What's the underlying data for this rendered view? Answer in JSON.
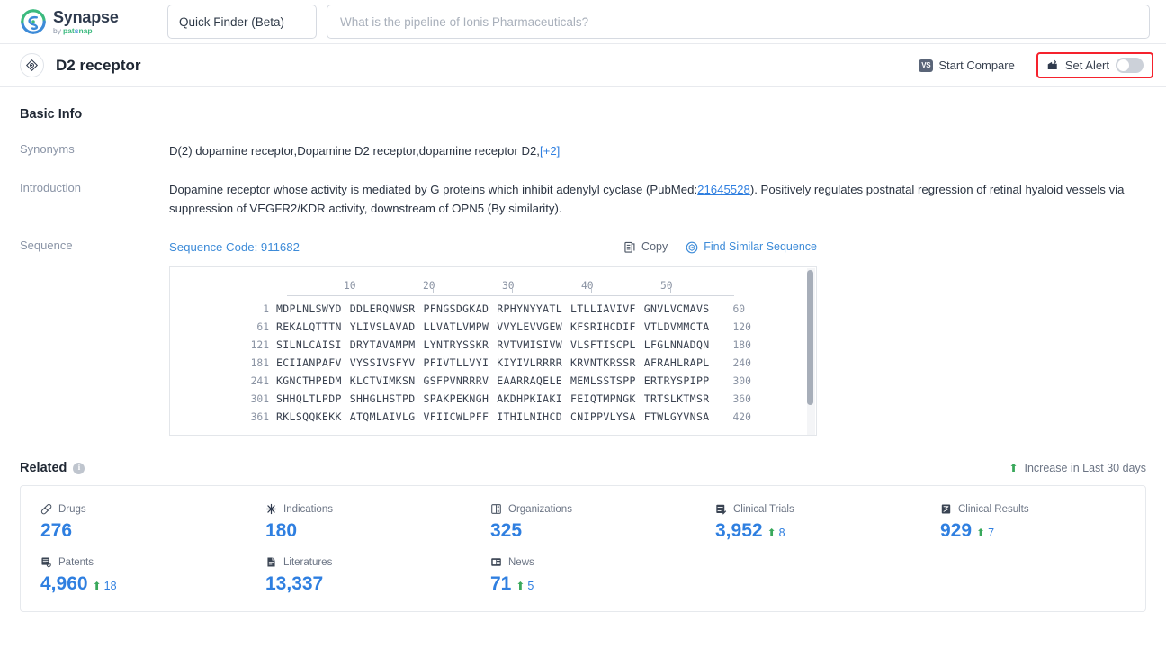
{
  "header": {
    "logo_name": "Synapse",
    "logo_sub_prefix": "by",
    "logo_sub_brand": "patsnap",
    "finder_label": "Quick Finder (Beta)",
    "search_placeholder": "What is the pipeline of Ionis Pharmaceuticals?",
    "caret_icon": "chevron-down-icon"
  },
  "titlebar": {
    "entity_icon": "target-diamond-icon",
    "title": "D2 receptor",
    "compare_label": "Start Compare",
    "compare_icon": "vs-icon",
    "vs_text": "VS",
    "alert_label": "Set Alert",
    "alert_icon": "alert-bell-icon",
    "alert_toggle_state": "off",
    "alert_highlight_color": "#f5222d"
  },
  "basic_info": {
    "section_title": "Basic Info",
    "synonyms_label": "Synonyms",
    "synonyms_value": "D(2) dopamine receptor,Dopamine D2 receptor,dopamine receptor D2,",
    "synonyms_more": "[+2]",
    "introduction_label": "Introduction",
    "introduction_part1": "Dopamine receptor whose activity is mediated by G proteins which inhibit adenylyl cyclase (PubMed:",
    "introduction_pubmed": "21645528",
    "introduction_part2": "). Positively regulates postnatal regression of retinal hyaloid vessels via suppression of VEGFR2/KDR activity, downstream of OPN5 (By similarity)."
  },
  "sequence": {
    "label": "Sequence",
    "code_text": "Sequence Code: 911682",
    "copy_label": "Copy",
    "copy_icon": "copy-icon",
    "find_similar_label": "Find Similar Sequence",
    "find_similar_icon": "find-similar-sequence-icon",
    "ruler_ticks": [
      "10",
      "20",
      "30",
      "40",
      "50"
    ],
    "lines": [
      {
        "start": "1",
        "chunks": [
          "MDPLNLSWYD",
          "DDLERQNWSR",
          "PFNGSDGKAD",
          "RPHYNYYATL",
          "LTLLIAVIVF",
          "GNVLVCMAVS"
        ],
        "end": "60"
      },
      {
        "start": "61",
        "chunks": [
          "REKALQTTTN",
          "YLIVSLAVAD",
          "LLVATLVMPW",
          "VVYLEVVGEW",
          "KFSRIHCDIF",
          "VTLDVMMCTA"
        ],
        "end": "120"
      },
      {
        "start": "121",
        "chunks": [
          "SILNLCAISI",
          "DRYTAVAMPM",
          "LYNTRYSSKR",
          "RVTVMISIVW",
          "VLSFTISCPL",
          "LFGLNNADQN"
        ],
        "end": "180"
      },
      {
        "start": "181",
        "chunks": [
          "ECIIANPAFV",
          "VYSSIVSFYV",
          "PFIVTLLVYI",
          "KIYIVLRRRR",
          "KRVNTKRSSR",
          "AFRAHLRAPL"
        ],
        "end": "240"
      },
      {
        "start": "241",
        "chunks": [
          "KGNCTHPEDM",
          "KLCTVIMKSN",
          "GSFPVNRRRV",
          "EAARRAQELE",
          "MEMLSSTSPP",
          "ERTRYSPIPP"
        ],
        "end": "300"
      },
      {
        "start": "301",
        "chunks": [
          "SHHQLTLPDP",
          "SHHGLHSTPD",
          "SPAKPEKNGH",
          "AKDHPKIAKI",
          "FEIQTMPNGK",
          "TRTSLKTMSR"
        ],
        "end": "360"
      },
      {
        "start": "361",
        "chunks": [
          "RKLSQQKEKK",
          "ATQMLAIVLG",
          "VFIICWLPFF",
          "ITHILNIHCD",
          "CNIPPVLYSA",
          "FTWLGYVNSA"
        ],
        "end": "420"
      }
    ]
  },
  "related": {
    "title": "Related",
    "info_icon": "info-icon",
    "info_glyph": "i",
    "increase_note": "Increase in Last 30 days",
    "increase_arrow": "up-arrow-icon",
    "items": [
      {
        "icon": "drugs-icon",
        "name": "Drugs",
        "value": "276",
        "delta": ""
      },
      {
        "icon": "indications-icon",
        "name": "Indications",
        "value": "180",
        "delta": ""
      },
      {
        "icon": "organizations-icon",
        "name": "Organizations",
        "value": "325",
        "delta": ""
      },
      {
        "icon": "clinical-trials-icon",
        "name": "Clinical Trials",
        "value": "3,952",
        "delta": "8"
      },
      {
        "icon": "clinical-results-icon",
        "name": "Clinical Results",
        "value": "929",
        "delta": "7"
      },
      {
        "icon": "patents-icon",
        "name": "Patents",
        "value": "4,960",
        "delta": "18"
      },
      {
        "icon": "literatures-icon",
        "name": "Literatures",
        "value": "13,337",
        "delta": ""
      },
      {
        "icon": "news-icon",
        "name": "News",
        "value": "71",
        "delta": "5"
      }
    ]
  },
  "colors": {
    "accent_blue": "#2f7fe0",
    "link_blue": "#3d8bd8",
    "increase_green": "#39a85b",
    "alert_red": "#f5222d"
  }
}
